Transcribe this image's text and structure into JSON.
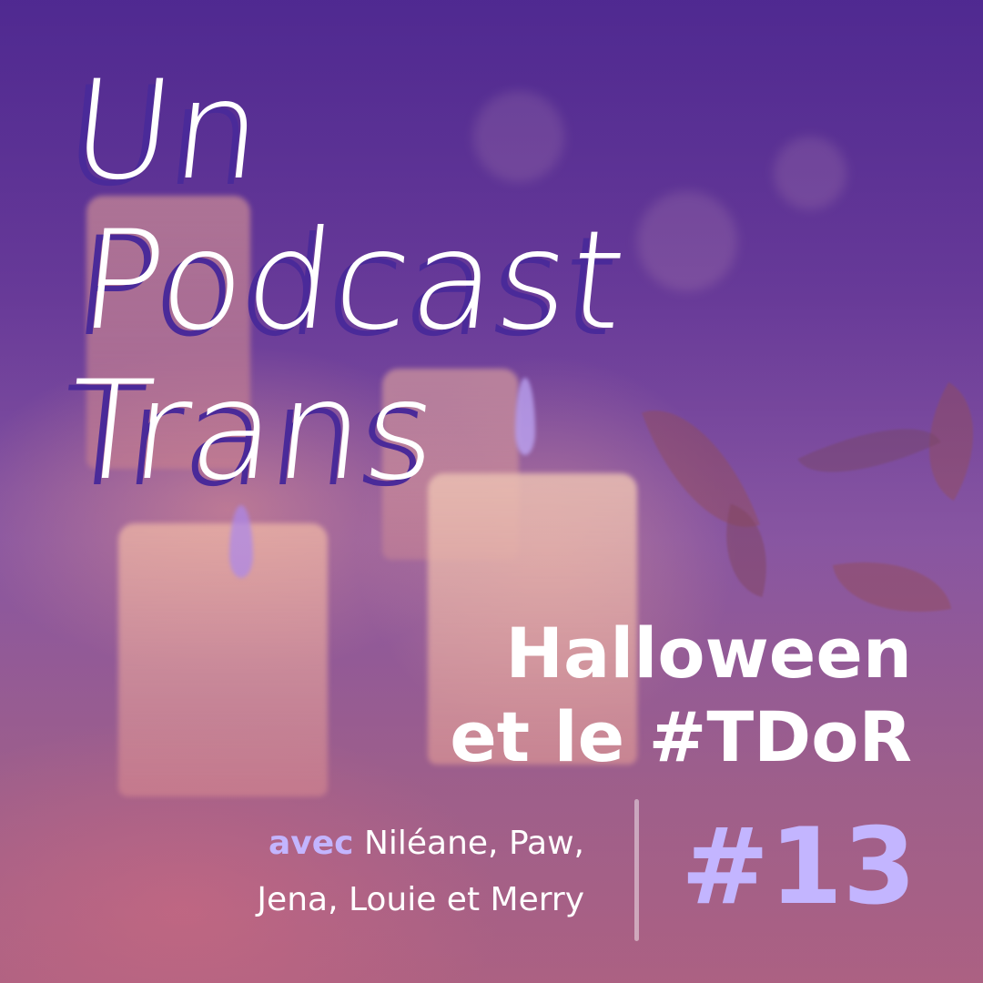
{
  "podcast_title": {
    "line1": "Un",
    "line2": "Podcast",
    "line3": "Trans"
  },
  "episode": {
    "title_line1": "Halloween",
    "title_line2": "et le #TDoR",
    "number": "#13"
  },
  "guests": {
    "prefix": "avec",
    "line1": "Niléane, Paw,",
    "line2": "Jena, Louie et Merry"
  },
  "colors": {
    "accent": "#c3b5ff",
    "title_shadow": "#4a2a99",
    "background_top": "#4f2a8e",
    "background_bottom": "#b36a86"
  }
}
